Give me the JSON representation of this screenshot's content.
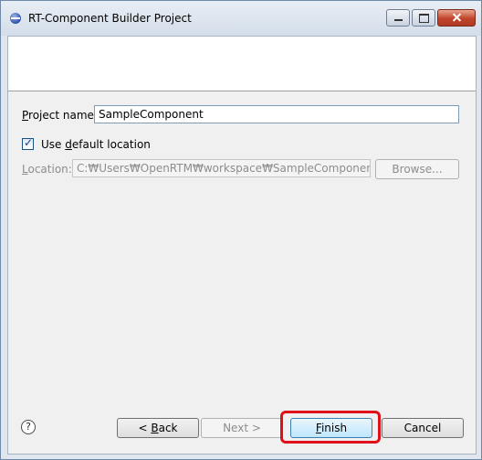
{
  "window": {
    "title": "RT-Component Builder Project"
  },
  "form": {
    "project_name": {
      "label_mnemonic": "P",
      "label_rest": "roject name:",
      "value": "SampleComponent"
    },
    "use_default_location": {
      "checked": true,
      "label_before": "Use ",
      "label_mnemonic": "d",
      "label_after": "efault location"
    },
    "location": {
      "label_mnemonic": "L",
      "label_rest": "ocation:",
      "value": "C:₩Users₩OpenRTM₩workspace₩SampleComponent",
      "browse_label": "Browse...",
      "enabled": false
    }
  },
  "buttons": {
    "help_icon": "question-mark",
    "back_prefix": "< ",
    "back_mnemonic": "B",
    "back_rest": "ack",
    "next_label": "Next >",
    "finish_mnemonic": "F",
    "finish_rest": "inish",
    "cancel_label": "Cancel"
  },
  "colors": {
    "highlight": "#e0101a"
  }
}
